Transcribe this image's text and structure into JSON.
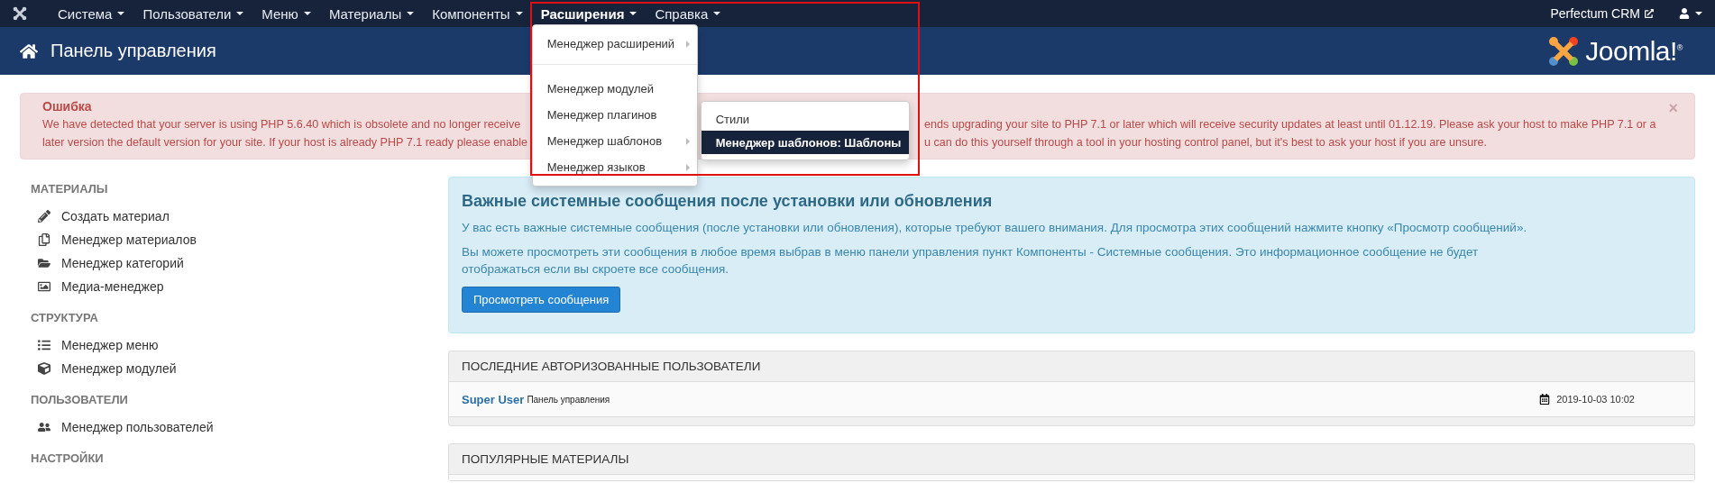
{
  "navbar": {
    "menus": [
      {
        "label": "Система",
        "active": false,
        "open": false
      },
      {
        "label": "Пользователи",
        "active": false,
        "open": false
      },
      {
        "label": "Меню",
        "active": false,
        "open": false
      },
      {
        "label": "Материалы",
        "active": false,
        "open": false
      },
      {
        "label": "Компоненты",
        "active": false,
        "open": false
      },
      {
        "label": "Расширения",
        "active": true,
        "open": true
      },
      {
        "label": "Справка",
        "active": false,
        "open": false
      }
    ],
    "dropdown": [
      {
        "kind": "item",
        "label": "Менеджер расширений",
        "has_arrow": true
      },
      {
        "kind": "divider"
      },
      {
        "kind": "item",
        "label": "Менеджер модулей",
        "has_arrow": false
      },
      {
        "kind": "item",
        "label": "Менеджер плагинов",
        "has_arrow": false
      },
      {
        "kind": "item",
        "label": "Менеджер шаблонов",
        "has_arrow": true,
        "submenu": [
          {
            "label": "Стили",
            "selected": false
          },
          {
            "label": "Менеджер шаблонов: Шаблоны",
            "selected": true
          }
        ]
      },
      {
        "kind": "item",
        "label": "Менеджер языков",
        "has_arrow": true
      }
    ],
    "site_link": "Perfectum CRM"
  },
  "header": {
    "title": "Панель управления",
    "logo_text": "Joomla!$^{®}$"
  },
  "error": {
    "title": "Ошибка",
    "lines": [
      [
        "We have detected that your server is using PHP 5.6.40 which is obsolete and no longer receive",
        "ends upgrading your site to PHP 7.1 or later which will receive security updates at least until 01.12.19. Please ask your host to make PHP 7.1 or a"
      ],
      [
        "later version the default version for your site. If your host is already PHP 7.1 ready please enable",
        "u can do this yourself through a tool in your hosting control panel, but it's best to ask your host if you are unsure."
      ]
    ],
    "close": "×"
  },
  "sidebar": [
    {
      "heading": "МАТЕРИАЛЫ",
      "items": [
        "Создать материал",
        "Менеджер материалов",
        "Менеджер категорий",
        "Медиа-менеджер"
      ]
    },
    {
      "heading": "СТРУКТУРА",
      "items": [
        "Менеджер меню",
        "Менеджер модулей"
      ]
    },
    {
      "heading": "ПОЛЬЗОВАТЕЛИ",
      "items": [
        "Менеджер пользователей"
      ]
    },
    {
      "heading": "НАСТРОЙКИ"
    }
  ],
  "info": {
    "title": "Важные системные сообщения после установки или обновления",
    "paragraphs": [
      "У вас есть важные системные сообщения (после установки или обновления), которые требуют вашего внимания. Для просмотра этих сообщений нажмите кнопку «Просмотр сообщений».",
      "Вы можете просмотреть эти сообщения в любое время выбрав в меню панели управления пункт Компоненты - Системные сообщения. Это информационное сообщение не будет отображаться если вы скроете все сообщения."
    ],
    "button": "Просмотреть сообщения"
  },
  "logged_users": {
    "title": "ПОСЛЕДНИЕ АВТОРИЗОВАННЫЕ ПОЛЬЗОВАТЕЛИ",
    "rows": [
      {
        "name": "Super User",
        "location": "Панель управления",
        "date": "2019-10-03 10:02"
      }
    ]
  },
  "popular": {
    "title": "ПОПУЛЯРНЫЕ МАТЕРИАЛЫ"
  }
}
